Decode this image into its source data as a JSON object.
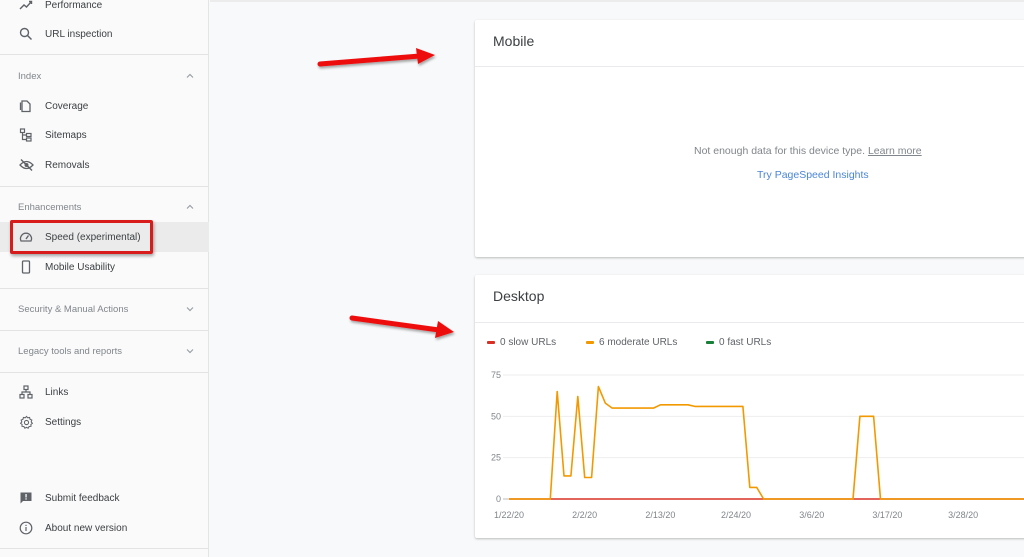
{
  "sidebar": {
    "top_items": [
      {
        "label": "Performance",
        "icon": "trending-up-icon"
      },
      {
        "label": "URL inspection",
        "icon": "search-icon"
      }
    ],
    "sections": [
      {
        "title": "Index",
        "expanded": true,
        "items": [
          {
            "label": "Coverage",
            "icon": "coverage-icon"
          },
          {
            "label": "Sitemaps",
            "icon": "sitemap-icon"
          },
          {
            "label": "Removals",
            "icon": "eye-off-icon"
          }
        ]
      },
      {
        "title": "Enhancements",
        "expanded": true,
        "items": [
          {
            "label": "Speed (experimental)",
            "icon": "speedometer-icon",
            "active": true
          },
          {
            "label": "Mobile Usability",
            "icon": "phone-icon"
          }
        ]
      },
      {
        "title": "Security & Manual Actions",
        "expanded": false,
        "items": []
      },
      {
        "title": "Legacy tools and reports",
        "expanded": false,
        "items": []
      }
    ],
    "bottom_items": [
      {
        "label": "Links",
        "icon": "links-icon"
      },
      {
        "label": "Settings",
        "icon": "gear-icon"
      }
    ],
    "footer_items": [
      {
        "label": "Submit feedback",
        "icon": "feedback-icon"
      },
      {
        "label": "About new version",
        "icon": "info-icon"
      }
    ]
  },
  "mobile_card": {
    "title": "Mobile",
    "message": "Not enough data for this device type.",
    "learn_more": "Learn more",
    "psi_link": "Try PageSpeed Insights"
  },
  "desktop_card": {
    "title": "Desktop"
  },
  "colors": {
    "slow": "#d93025",
    "moderate": "#f29900",
    "fast": "#188038",
    "link": "#4a86d8",
    "annotation": "#e01010"
  },
  "chart_data": {
    "type": "line",
    "title": "Desktop",
    "xlabel": "",
    "ylabel": "",
    "ylim": [
      0,
      75
    ],
    "yticks": [
      0,
      25,
      50,
      75
    ],
    "x_tick_labels": [
      "1/22/20",
      "2/2/20",
      "2/13/20",
      "2/24/20",
      "3/6/20",
      "3/17/20",
      "3/28/20"
    ],
    "x_tick_days": [
      0,
      11,
      22,
      33,
      44,
      55,
      66
    ],
    "x_start_date": "1/22/20",
    "x_range_days": [
      0,
      75
    ],
    "grid": true,
    "legend_position": "top-left",
    "legend": [
      {
        "label": "0 slow URLs",
        "series": "slow"
      },
      {
        "label": "6 moderate URLs",
        "series": "moderate"
      },
      {
        "label": "0 fast URLs",
        "series": "fast"
      }
    ],
    "series": [
      {
        "name": "moderate",
        "color": "#f29900",
        "points": [
          [
            0,
            0
          ],
          [
            6,
            0
          ],
          [
            7,
            65
          ],
          [
            8,
            14
          ],
          [
            9,
            14
          ],
          [
            10,
            62
          ],
          [
            11,
            13
          ],
          [
            12,
            13
          ],
          [
            13,
            68
          ],
          [
            14,
            58
          ],
          [
            15,
            55
          ],
          [
            16,
            55
          ],
          [
            17,
            55
          ],
          [
            18,
            55
          ],
          [
            19,
            55
          ],
          [
            20,
            55
          ],
          [
            21,
            55
          ],
          [
            22,
            57
          ],
          [
            23,
            57
          ],
          [
            24,
            57
          ],
          [
            25,
            57
          ],
          [
            26,
            57
          ],
          [
            27,
            56
          ],
          [
            28,
            56
          ],
          [
            29,
            56
          ],
          [
            30,
            56
          ],
          [
            31,
            56
          ],
          [
            32,
            56
          ],
          [
            33,
            56
          ],
          [
            34,
            56
          ],
          [
            35,
            7
          ],
          [
            36,
            7
          ],
          [
            37,
            0
          ],
          [
            50,
            0
          ],
          [
            51,
            50
          ],
          [
            52,
            50
          ],
          [
            53,
            50
          ],
          [
            54,
            0
          ],
          [
            75,
            0
          ]
        ]
      },
      {
        "name": "slow",
        "color": "#d93025",
        "points": [
          [
            0,
            0
          ],
          [
            75,
            0
          ]
        ]
      }
    ]
  }
}
